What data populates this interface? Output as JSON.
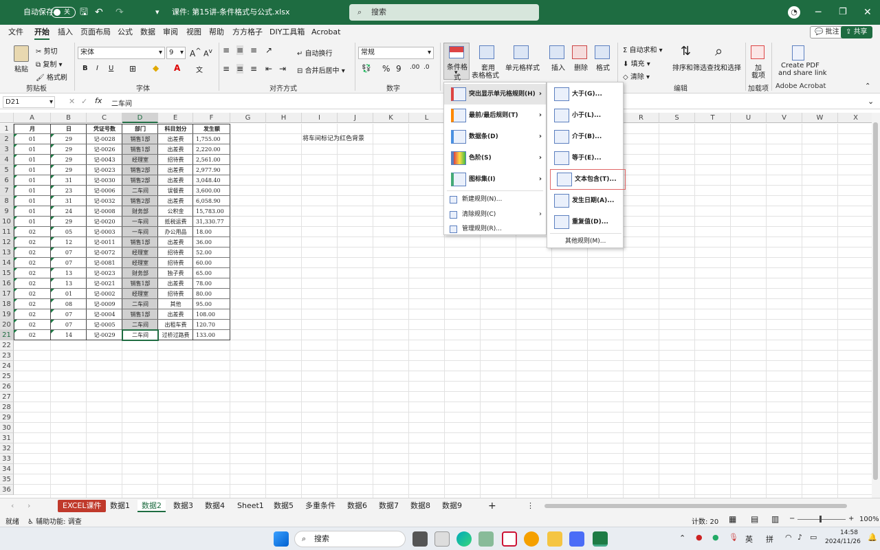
{
  "titlebar": {
    "autosave_label": "自动保存",
    "autosave_state": "关",
    "filename": "课件: 第15讲-条件格式与公式.xlsx",
    "search_placeholder": "搜索"
  },
  "menubar": {
    "items": [
      "文件",
      "开始",
      "插入",
      "页面布局",
      "公式",
      "数据",
      "审阅",
      "视图",
      "帮助",
      "方方格子",
      "DIY工具箱",
      "Acrobat"
    ],
    "active": "开始",
    "comment_button": "批注",
    "share_button": "共享"
  },
  "ribbon": {
    "clipboard": {
      "paste": "粘贴",
      "cut": "剪切",
      "copy": "复制",
      "format_painter": "格式刷",
      "group": "剪贴板"
    },
    "font": {
      "name": "宋体",
      "size": "9",
      "bold": "B",
      "italic": "I",
      "underline": "U",
      "group": "字体"
    },
    "alignment": {
      "wrap": "自动换行",
      "merge": "合并后居中",
      "group": "对齐方式"
    },
    "number": {
      "format": "常规",
      "group": "数字"
    },
    "styles": {
      "conditional": "条件格式",
      "table_format_1": "套用",
      "table_format_2": "表格格式",
      "cell_styles": "单元格样式"
    },
    "cells": {
      "insert": "插入",
      "delete": "删除",
      "format": "格式"
    },
    "editing": {
      "autosum": "自动求和",
      "fill": "填充",
      "clear": "清除",
      "sort": "排序和筛选",
      "find": "查找和选择",
      "group": "编辑"
    },
    "addins": {
      "label_1": "加",
      "label_2": "载项",
      "group": "加载项"
    },
    "acrobat": {
      "label_1": "Create PDF",
      "label_2": "and share link",
      "group": "Adobe Acrobat"
    }
  },
  "formula_bar": {
    "name_box": "D21",
    "fx": "fx",
    "value": "二车间"
  },
  "columns": [
    "A",
    "B",
    "C",
    "D",
    "E",
    "F",
    "G",
    "H",
    "I",
    "J",
    "K",
    "L",
    "M",
    "N",
    "O",
    "P",
    "Q",
    "R",
    "S",
    "T",
    "U",
    "V",
    "W",
    "X"
  ],
  "rows": [
    "1",
    "2",
    "3",
    "4",
    "5",
    "6",
    "7",
    "8",
    "9",
    "10",
    "11",
    "12",
    "13",
    "14",
    "15",
    "16",
    "17",
    "18",
    "19",
    "20",
    "21",
    "22",
    "23",
    "24",
    "25",
    "26",
    "27",
    "28",
    "29",
    "30",
    "31",
    "32",
    "33",
    "34",
    "35",
    "36"
  ],
  "table": {
    "headers": [
      "月",
      "日",
      "凭证号数",
      "部门",
      "科目划分",
      "发生额"
    ],
    "rows": [
      [
        "01",
        "29",
        "记-0028",
        "销售1部",
        "出差费",
        "1,755.00"
      ],
      [
        "01",
        "29",
        "记-0026",
        "销售1部",
        "出差费",
        "2,220.00"
      ],
      [
        "01",
        "29",
        "记-0043",
        "经理室",
        "招待费",
        "2,561.00"
      ],
      [
        "01",
        "29",
        "记-0023",
        "销售2部",
        "出差费",
        "2,977.90"
      ],
      [
        "01",
        "31",
        "记-0030",
        "销售2部",
        "出差费",
        "3,048.40"
      ],
      [
        "01",
        "23",
        "记-0006",
        "二车间",
        "误餐费",
        "3,600.00"
      ],
      [
        "01",
        "31",
        "记-0032",
        "销售2部",
        "出差费",
        "6,058.90"
      ],
      [
        "01",
        "24",
        "记-0008",
        "财务部",
        "公积金",
        "15,783.00"
      ],
      [
        "01",
        "29",
        "记-0020",
        "一车间",
        "抵税运费",
        "31,330.77"
      ],
      [
        "02",
        "05",
        "记-0003",
        "一车间",
        "办公用品",
        "18.00"
      ],
      [
        "02",
        "12",
        "记-0011",
        "销售1部",
        "出差费",
        "36.00"
      ],
      [
        "02",
        "07",
        "记-0072",
        "经理室",
        "招待费",
        "52.00"
      ],
      [
        "02",
        "07",
        "记-0081",
        "经理室",
        "招待费",
        "60.00"
      ],
      [
        "02",
        "13",
        "记-0023",
        "财务部",
        "独子费",
        "65.00"
      ],
      [
        "02",
        "13",
        "记-0021",
        "销售1部",
        "出差费",
        "78.00"
      ],
      [
        "02",
        "01",
        "记-0002",
        "经理室",
        "招待费",
        "80.00"
      ],
      [
        "02",
        "08",
        "记-0009",
        "二车间",
        "其他",
        "95.00"
      ],
      [
        "02",
        "07",
        "记-0004",
        "销售1部",
        "出差费",
        "108.00"
      ],
      [
        "02",
        "07",
        "记-0005",
        "二车间",
        "出租车费",
        "120.70"
      ],
      [
        "02",
        "14",
        "记-0029",
        "二车间",
        "过桥过路费",
        "133.00"
      ]
    ]
  },
  "note": "将车间标记为红色背景",
  "cf_menu": [
    {
      "label": "突出显示单元格规则(H)",
      "submenu": true
    },
    {
      "label": "最前/最后规则(T)",
      "submenu": true
    },
    {
      "label": "数据条(D)",
      "submenu": true
    },
    {
      "label": "色阶(S)",
      "submenu": true
    },
    {
      "label": "图标集(I)",
      "submenu": true
    },
    {
      "label": "新建规则(N)...",
      "submenu": false
    },
    {
      "label": "清除规则(C)",
      "submenu": true
    },
    {
      "label": "管理规则(R)...",
      "submenu": false
    }
  ],
  "highlight_submenu": [
    "大于(G)...",
    "小于(L)...",
    "介于(B)...",
    "等于(E)...",
    "文本包含(T)...",
    "发生日期(A)...",
    "重复值(D)...",
    "其他规则(M)..."
  ],
  "sheet_tabs": [
    "EXCEL课件",
    "数据1",
    "数据2",
    "数据3",
    "数据4",
    "Sheet1",
    "数据5",
    "多重条件",
    "数据6",
    "数据7",
    "数据8",
    "数据9"
  ],
  "active_sheet": "数据2",
  "statusbar": {
    "ready": "就绪",
    "accessibility": "辅助功能: 调查",
    "count": "计数: 20",
    "zoom": "100%"
  },
  "taskbar": {
    "search": "搜索",
    "ime_1": "英",
    "ime_2": "拼",
    "time": "14:58",
    "date": "2024/11/26"
  },
  "colors": {
    "excel_green": "#1e6c41",
    "dept_fill": "#d0d0d0",
    "hover": "#e5e5e5",
    "highlight_border": "#e06666"
  }
}
